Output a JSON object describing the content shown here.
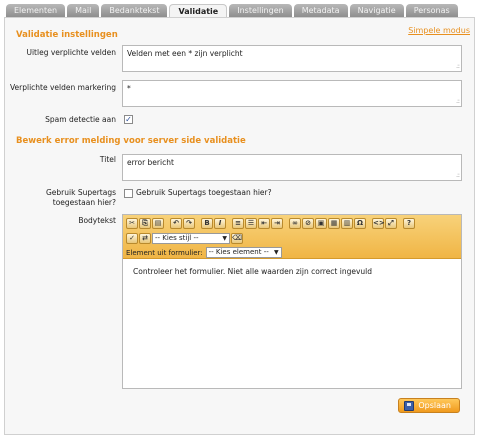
{
  "tabs": [
    {
      "label": "Elementen"
    },
    {
      "label": "Mail"
    },
    {
      "label": "Bedanktekst"
    },
    {
      "label": "Validatie",
      "active": true
    },
    {
      "label": "Instellingen"
    },
    {
      "label": "Metadata"
    },
    {
      "label": "Navigatie"
    },
    {
      "label": "Personas"
    }
  ],
  "header": {
    "simple_mode_link": "Simpele modus"
  },
  "validation": {
    "title": "Validatie instellingen",
    "explain_label": "Uitleg verplichte velden",
    "explain_value": "Velden met een * zijn verplicht",
    "marker_label": "Verplichte velden markering",
    "marker_value": "*",
    "spam_label": "Spam detectie aan",
    "spam_checked": true
  },
  "error": {
    "title": "Bewerk error melding voor server side validatie",
    "title_label": "Titel",
    "title_value": "error bericht",
    "supertags_label_line1": "Gebruik Supertags",
    "supertags_label_line2": "toegestaan hier?",
    "supertags_checkbox_label": "Gebruik Supertags toegestaan hier?",
    "supertags_checked": false,
    "body_label": "Bodytekst",
    "style_select": "-- Kies stijl --",
    "element_label": "Element uit formulier:",
    "element_select": "-- Kies element --",
    "body_text": "Controleer het formulier. Niet alle waarden zijn correct ingevuld"
  },
  "footer": {
    "save_label": "Opslaan"
  },
  "colors": {
    "accent": "#e8901f",
    "toolbar": "#f0b545"
  }
}
